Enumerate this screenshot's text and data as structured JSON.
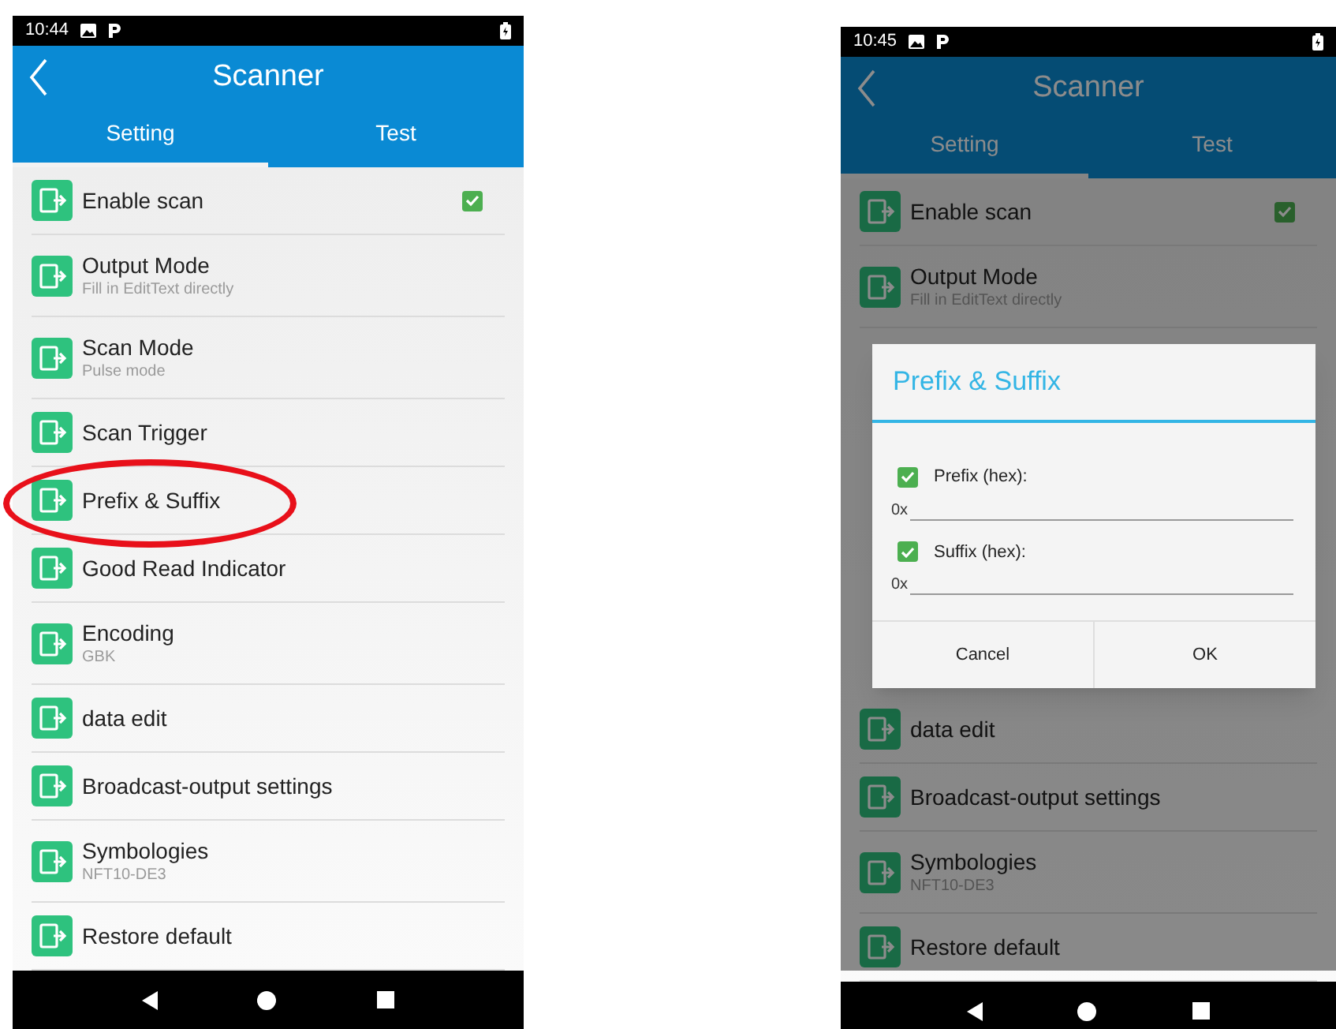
{
  "phones": [
    {
      "status_bar": {
        "time": "10:44"
      },
      "title": "Scanner",
      "tabs": [
        {
          "label": "Setting",
          "selected": true
        },
        {
          "label": "Test",
          "selected": false
        }
      ],
      "items": [
        {
          "title": "Enable scan",
          "checked": true
        },
        {
          "title": "Output Mode",
          "subtitle": "Fill in EditText directly"
        },
        {
          "title": "Scan Mode",
          "subtitle": "Pulse mode"
        },
        {
          "title": "Scan Trigger"
        },
        {
          "title": "Prefix & Suffix",
          "highlighted": true
        },
        {
          "title": "Good Read Indicator"
        },
        {
          "title": "Encoding",
          "subtitle": "GBK"
        },
        {
          "title": "data edit"
        },
        {
          "title": "Broadcast-output settings"
        },
        {
          "title": "Symbologies",
          "subtitle": "NFT10-DE3"
        },
        {
          "title": "Restore default"
        }
      ]
    },
    {
      "status_bar": {
        "time": "10:45"
      },
      "title": "Scanner",
      "dimmed": true,
      "tabs": [
        {
          "label": "Setting",
          "selected": true
        },
        {
          "label": "Test",
          "selected": false
        }
      ],
      "items": [
        {
          "title": "Enable scan",
          "checked": true
        },
        {
          "title": "Output Mode",
          "subtitle": "Fill in EditText directly"
        },
        {
          "kind": "covered"
        },
        {
          "title": "data edit"
        },
        {
          "title": "Broadcast-output settings"
        },
        {
          "title": "Symbologies",
          "subtitle": "NFT10-DE3"
        },
        {
          "title": "Restore default"
        }
      ],
      "dialog": {
        "title": "Prefix & Suffix",
        "fields": [
          {
            "label": "Prefix (hex):",
            "checked": true,
            "prefix": "0x"
          },
          {
            "label": "Suffix (hex):",
            "checked": true,
            "prefix": "0x"
          }
        ],
        "buttons": [
          "Cancel",
          "OK"
        ]
      }
    }
  ]
}
